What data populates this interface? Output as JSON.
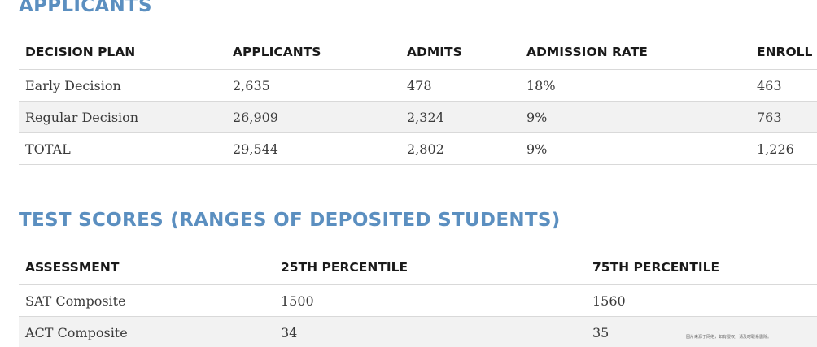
{
  "applicants": {
    "title": "APPLICANTS",
    "columns": [
      "DECISION PLAN",
      "APPLICANTS",
      "ADMITS",
      "ADMISSION RATE",
      "ENROLL"
    ],
    "rows": [
      [
        "Early Decision",
        "2,635",
        "478",
        "18%",
        "463"
      ],
      [
        "Regular Decision",
        "26,909",
        "2,324",
        "9%",
        "763"
      ],
      [
        "TOTAL",
        "29,544",
        "2,802",
        "9%",
        "1,226"
      ]
    ]
  },
  "test_scores": {
    "title": "TEST SCORES (RANGES OF DEPOSITED STUDENTS)",
    "columns": [
      "ASSESSMENT",
      "25TH PERCENTILE",
      "75TH PERCENTILE"
    ],
    "rows": [
      [
        "SAT Composite",
        "1500",
        "1560"
      ],
      [
        "ACT Composite",
        "34",
        "35"
      ]
    ]
  },
  "watermark": "图片来源于网络，如有侵权，请及时联系删除。",
  "colors": {
    "heading": "#5b8fc0",
    "stripe": "#f2f2f2",
    "rule": "#d9d9d9"
  }
}
